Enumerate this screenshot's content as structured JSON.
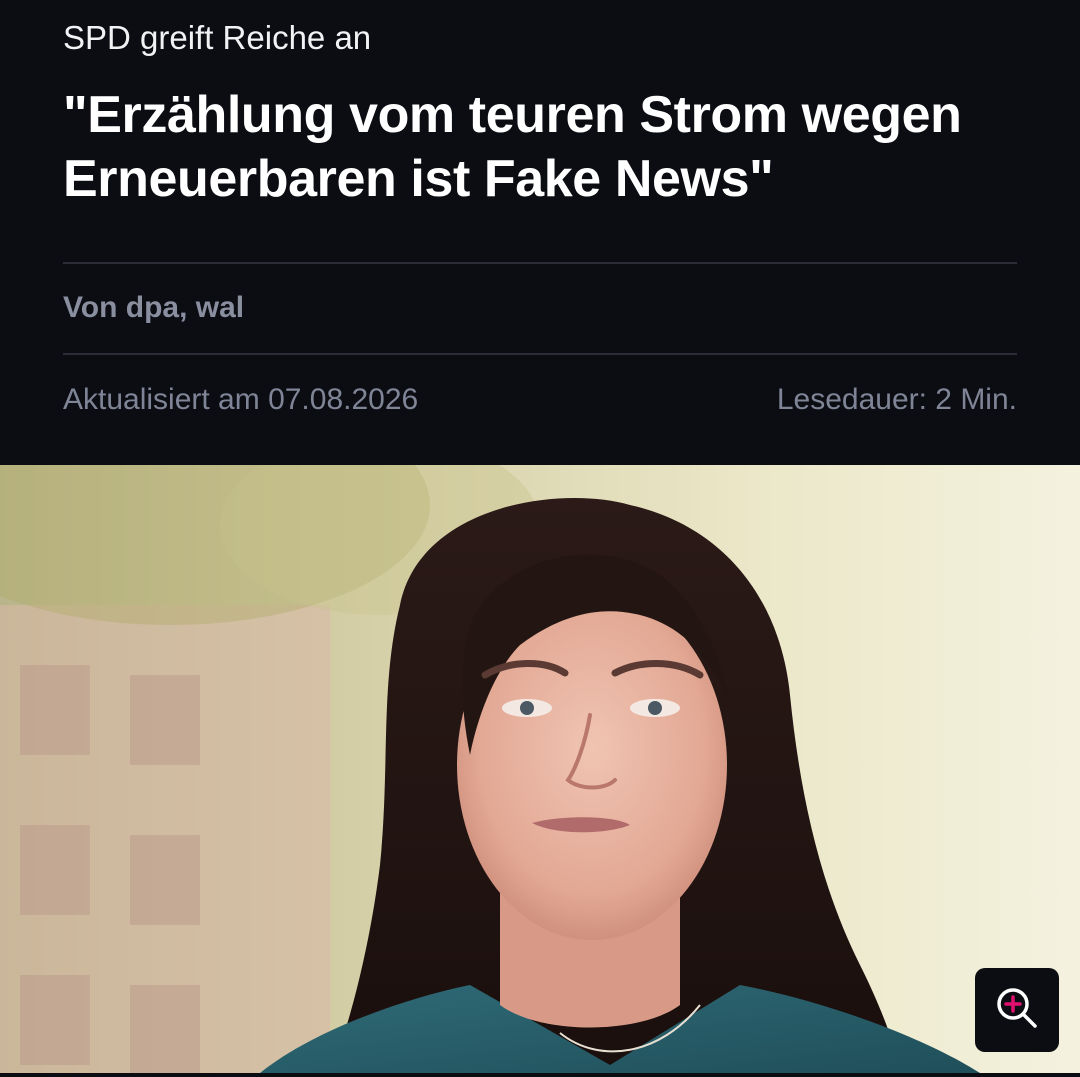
{
  "article": {
    "kicker": "SPD greift Reiche an",
    "headline": "\"Erzählung vom teuren Strom wegen Erneuerbaren ist Fake News\"",
    "byline": "Von dpa, wal",
    "updated": "Aktualisiert am 07.08.2026",
    "read_time": "Lesedauer: 2 Min."
  },
  "image": {
    "icon": "zoom-in-icon"
  },
  "colors": {
    "background": "#0b0d13",
    "headline": "#ffffff",
    "meta": "#7f8596",
    "divider": "#2a2d36",
    "zoom_accent": "#e0106f"
  }
}
